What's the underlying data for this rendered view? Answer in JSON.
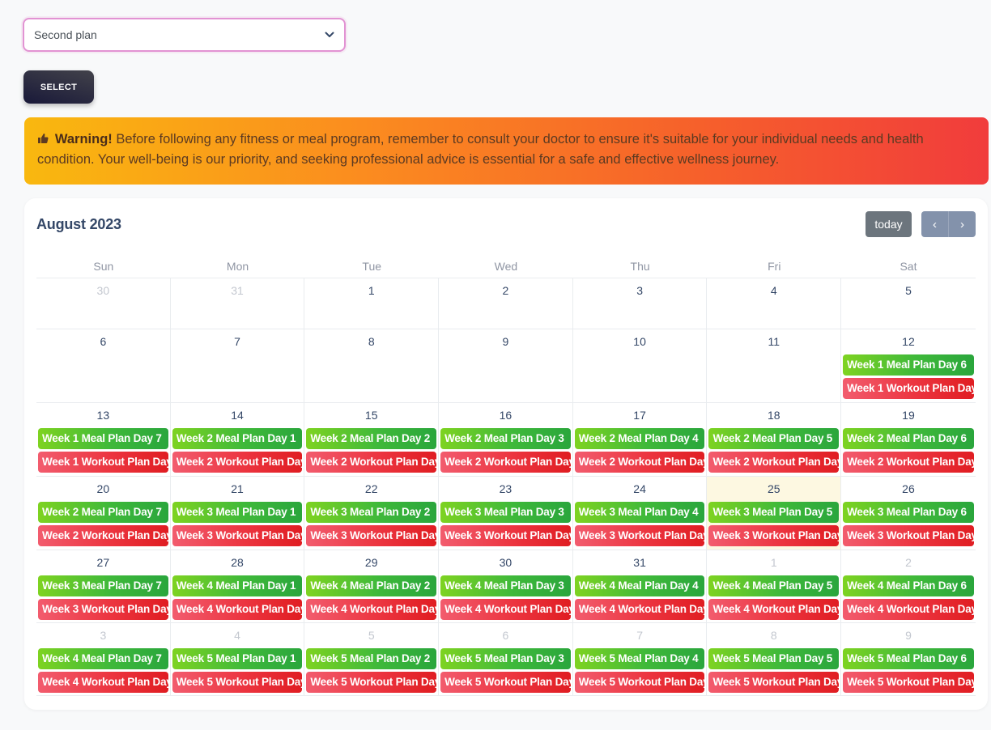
{
  "plan_select": {
    "value": "Second plan"
  },
  "select_button": {
    "label": "SELECT"
  },
  "warning": {
    "bold": "Warning!",
    "text": " Before following any fitness or meal program, remember to consult your doctor to ensure it's suitable for your individual needs and health condition. Your well-being is our priority, and seeking professional advice is essential for a safe and effective wellness journey."
  },
  "calendar": {
    "title": "August 2023",
    "today_label": "today",
    "prev_label": "‹",
    "next_label": "›",
    "day_headers": [
      "Sun",
      "Mon",
      "Tue",
      "Wed",
      "Thu",
      "Fri",
      "Sat"
    ],
    "weeks": [
      [
        {
          "num": "30",
          "other": true,
          "events": []
        },
        {
          "num": "31",
          "other": true,
          "events": []
        },
        {
          "num": "1",
          "events": []
        },
        {
          "num": "2",
          "events": []
        },
        {
          "num": "3",
          "events": []
        },
        {
          "num": "4",
          "events": []
        },
        {
          "num": "5",
          "events": []
        }
      ],
      [
        {
          "num": "6",
          "events": []
        },
        {
          "num": "7",
          "events": []
        },
        {
          "num": "8",
          "events": []
        },
        {
          "num": "9",
          "events": []
        },
        {
          "num": "10",
          "events": []
        },
        {
          "num": "11",
          "events": []
        },
        {
          "num": "12",
          "events": [
            {
              "type": "meal",
              "title": "Week 1 Meal Plan Day 6"
            },
            {
              "type": "workout",
              "title": "Week 1 Workout Plan Day"
            }
          ]
        }
      ],
      [
        {
          "num": "13",
          "events": [
            {
              "type": "meal",
              "title": "Week 1 Meal Plan Day 7"
            },
            {
              "type": "workout",
              "title": "Week 1 Workout Plan Day"
            }
          ]
        },
        {
          "num": "14",
          "events": [
            {
              "type": "meal",
              "title": "Week 2 Meal Plan Day 1"
            },
            {
              "type": "workout",
              "title": "Week 2 Workout Plan Day"
            }
          ]
        },
        {
          "num": "15",
          "events": [
            {
              "type": "meal",
              "title": "Week 2 Meal Plan Day 2"
            },
            {
              "type": "workout",
              "title": "Week 2 Workout Plan Day"
            }
          ]
        },
        {
          "num": "16",
          "events": [
            {
              "type": "meal",
              "title": "Week 2 Meal Plan Day 3"
            },
            {
              "type": "workout",
              "title": "Week 2 Workout Plan Day"
            }
          ]
        },
        {
          "num": "17",
          "events": [
            {
              "type": "meal",
              "title": "Week 2 Meal Plan Day 4"
            },
            {
              "type": "workout",
              "title": "Week 2 Workout Plan Day"
            }
          ]
        },
        {
          "num": "18",
          "events": [
            {
              "type": "meal",
              "title": "Week 2 Meal Plan Day 5"
            },
            {
              "type": "workout",
              "title": "Week 2 Workout Plan Day"
            }
          ]
        },
        {
          "num": "19",
          "events": [
            {
              "type": "meal",
              "title": "Week 2 Meal Plan Day 6"
            },
            {
              "type": "workout",
              "title": "Week 2 Workout Plan Day"
            }
          ]
        }
      ],
      [
        {
          "num": "20",
          "events": [
            {
              "type": "meal",
              "title": "Week 2 Meal Plan Day 7"
            },
            {
              "type": "workout",
              "title": "Week 2 Workout Plan Day"
            }
          ]
        },
        {
          "num": "21",
          "events": [
            {
              "type": "meal",
              "title": "Week 3 Meal Plan Day 1"
            },
            {
              "type": "workout",
              "title": "Week 3 Workout Plan Day"
            }
          ]
        },
        {
          "num": "22",
          "events": [
            {
              "type": "meal",
              "title": "Week 3 Meal Plan Day 2"
            },
            {
              "type": "workout",
              "title": "Week 3 Workout Plan Day"
            }
          ]
        },
        {
          "num": "23",
          "events": [
            {
              "type": "meal",
              "title": "Week 3 Meal Plan Day 3"
            },
            {
              "type": "workout",
              "title": "Week 3 Workout Plan Day"
            }
          ]
        },
        {
          "num": "24",
          "events": [
            {
              "type": "meal",
              "title": "Week 3 Meal Plan Day 4"
            },
            {
              "type": "workout",
              "title": "Week 3 Workout Plan Day"
            }
          ]
        },
        {
          "num": "25",
          "today": true,
          "events": [
            {
              "type": "meal",
              "title": "Week 3 Meal Plan Day 5"
            },
            {
              "type": "workout",
              "title": "Week 3 Workout Plan Day"
            }
          ]
        },
        {
          "num": "26",
          "events": [
            {
              "type": "meal",
              "title": "Week 3 Meal Plan Day 6"
            },
            {
              "type": "workout",
              "title": "Week 3 Workout Plan Day"
            }
          ]
        }
      ],
      [
        {
          "num": "27",
          "events": [
            {
              "type": "meal",
              "title": "Week 3 Meal Plan Day 7"
            },
            {
              "type": "workout",
              "title": "Week 3 Workout Plan Day"
            }
          ]
        },
        {
          "num": "28",
          "events": [
            {
              "type": "meal",
              "title": "Week 4 Meal Plan Day 1"
            },
            {
              "type": "workout",
              "title": "Week 4 Workout Plan Day"
            }
          ]
        },
        {
          "num": "29",
          "events": [
            {
              "type": "meal",
              "title": "Week 4 Meal Plan Day 2"
            },
            {
              "type": "workout",
              "title": "Week 4 Workout Plan Day"
            }
          ]
        },
        {
          "num": "30",
          "events": [
            {
              "type": "meal",
              "title": "Week 4 Meal Plan Day 3"
            },
            {
              "type": "workout",
              "title": "Week 4 Workout Plan Day"
            }
          ]
        },
        {
          "num": "31",
          "events": [
            {
              "type": "meal",
              "title": "Week 4 Meal Plan Day 4"
            },
            {
              "type": "workout",
              "title": "Week 4 Workout Plan Day"
            }
          ]
        },
        {
          "num": "1",
          "other": true,
          "events": [
            {
              "type": "meal",
              "title": "Week 4 Meal Plan Day 5"
            },
            {
              "type": "workout",
              "title": "Week 4 Workout Plan Day"
            }
          ]
        },
        {
          "num": "2",
          "other": true,
          "events": [
            {
              "type": "meal",
              "title": "Week 4 Meal Plan Day 6"
            },
            {
              "type": "workout",
              "title": "Week 4 Workout Plan Day"
            }
          ]
        }
      ],
      [
        {
          "num": "3",
          "other": true,
          "events": [
            {
              "type": "meal",
              "title": "Week 4 Meal Plan Day 7"
            },
            {
              "type": "workout",
              "title": "Week 4 Workout Plan Day"
            }
          ]
        },
        {
          "num": "4",
          "other": true,
          "events": [
            {
              "type": "meal",
              "title": "Week 5 Meal Plan Day 1"
            },
            {
              "type": "workout",
              "title": "Week 5 Workout Plan Day"
            }
          ]
        },
        {
          "num": "5",
          "other": true,
          "events": [
            {
              "type": "meal",
              "title": "Week 5 Meal Plan Day 2"
            },
            {
              "type": "workout",
              "title": "Week 5 Workout Plan Day"
            }
          ]
        },
        {
          "num": "6",
          "other": true,
          "events": [
            {
              "type": "meal",
              "title": "Week 5 Meal Plan Day 3"
            },
            {
              "type": "workout",
              "title": "Week 5 Workout Plan Day"
            }
          ]
        },
        {
          "num": "7",
          "other": true,
          "events": [
            {
              "type": "meal",
              "title": "Week 5 Meal Plan Day 4"
            },
            {
              "type": "workout",
              "title": "Week 5 Workout Plan Day"
            }
          ]
        },
        {
          "num": "8",
          "other": true,
          "events": [
            {
              "type": "meal",
              "title": "Week 5 Meal Plan Day 5"
            },
            {
              "type": "workout",
              "title": "Week 5 Workout Plan Day"
            }
          ]
        },
        {
          "num": "9",
          "other": true,
          "events": [
            {
              "type": "meal",
              "title": "Week 5 Meal Plan Day 6"
            },
            {
              "type": "workout",
              "title": "Week 5 Workout Plan Day"
            }
          ]
        }
      ]
    ]
  }
}
